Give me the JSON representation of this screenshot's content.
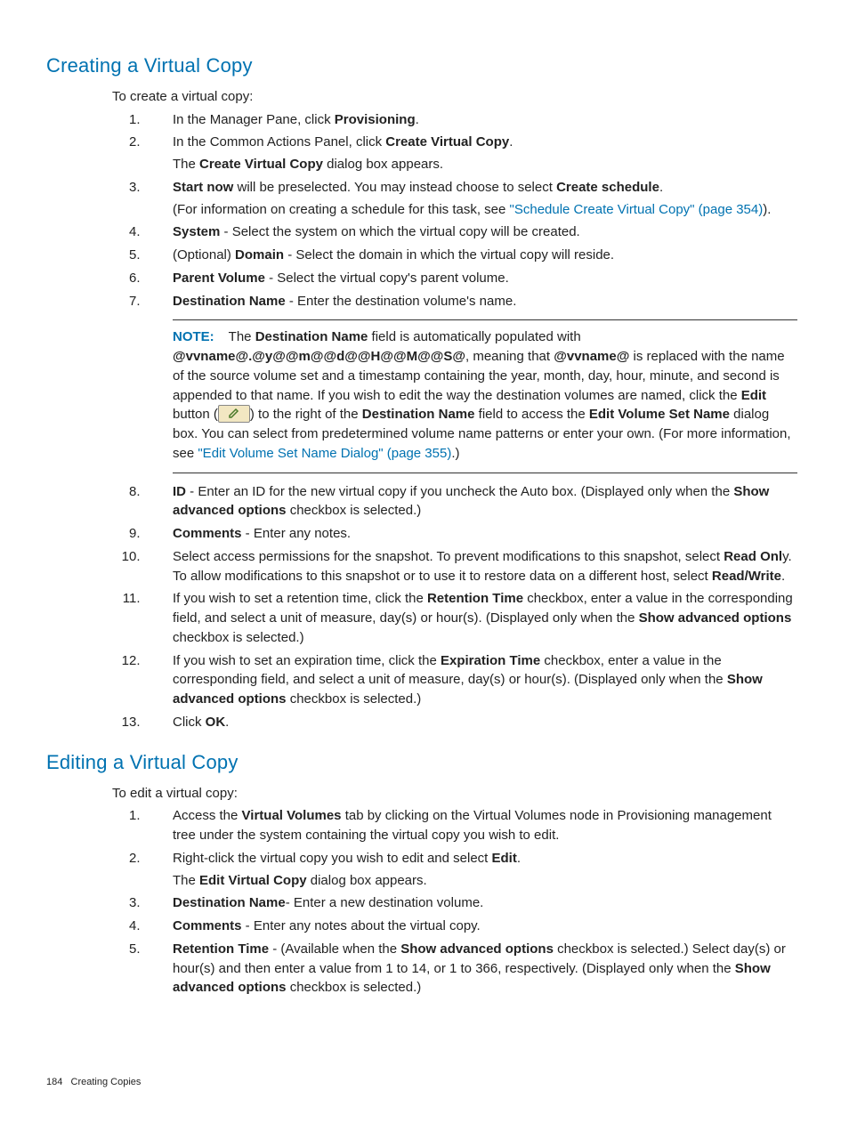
{
  "section1": {
    "title": "Creating a Virtual Copy",
    "intro": "To create a virtual copy:",
    "steps": {
      "s1a": "In the Manager Pane, click ",
      "s1b": "Provisioning",
      "s1c": ".",
      "s2a": "In the Common Actions Panel, click ",
      "s2b": "Create Virtual Copy",
      "s2c": ".",
      "s2d": "The ",
      "s2e": "Create Virtual Copy",
      "s2f": " dialog box appears.",
      "s3a": "Start now",
      "s3b": " will be preselected. You may instead choose to select ",
      "s3c": "Create schedule",
      "s3d": ".",
      "s3e": "(For information on creating a schedule for this task, see ",
      "s3f": "\"Schedule Create Virtual Copy\" (page 354)",
      "s3g": ").",
      "s4a": "System",
      "s4b": " - Select the system on which the virtual copy will be created.",
      "s5a": "(Optional) ",
      "s5b": "Domain",
      "s5c": " - Select the domain in which the virtual copy will reside.",
      "s6a": "Parent Volume",
      "s6b": " - Select the virtual copy's parent volume.",
      "s7a": "Destination Name",
      "s7b": " - Enter the destination volume's name.",
      "note": {
        "label": "NOTE:",
        "n1": "The ",
        "n2": "Destination Name",
        "n3": " field is automatically populated with ",
        "n4": "@vvname@.@y@@m@@d@@H@@M@@S@",
        "n5": ", meaning that ",
        "n6": "@vvname@",
        "n7": " is replaced with the name of the source volume set and a timestamp containing the year, month, day, hour, minute, and second is appended to that name. If you wish to edit the way the destination volumes are named, click the ",
        "n8": "Edit",
        "n9": " button (",
        "n10": ") to the right of the ",
        "n11": "Destination Name",
        "n12": " field to access the ",
        "n13": "Edit Volume Set Name",
        "n14": " dialog box. You can select from predetermined volume name patterns or enter your own. (For more information, see ",
        "n15": "\"Edit Volume Set Name Dialog\" (page 355)",
        "n16": ".)"
      },
      "s8a": "ID",
      "s8b": " - Enter an ID for the new virtual copy if you uncheck the Auto box. (Displayed only when the ",
      "s8c": "Show advanced options",
      "s8d": " checkbox is selected.)",
      "s9a": "Comments",
      "s9b": " - Enter any notes.",
      "s10a": "Select access permissions for the snapshot. To prevent modifications to this snapshot, select ",
      "s10b": "Read Onl",
      "s10c": "y. To allow modifications to this snapshot or to use it to restore data on a different host, select ",
      "s10d": "Read/Write",
      "s10e": ".",
      "s11a": "If you wish to set a retention time, click the ",
      "s11b": "Retention Time",
      "s11c": " checkbox, enter a value in the corresponding field, and select a unit of measure, day(s) or hour(s). (Displayed only when the ",
      "s11d": "Show advanced options",
      "s11e": " checkbox is selected.)",
      "s12a": "If you wish to set an expiration time, click the ",
      "s12b": "Expiration Time",
      "s12c": " checkbox, enter a value in the corresponding field, and select a unit of measure, day(s) or hour(s). (Displayed only when the ",
      "s12d": "Show advanced options",
      "s12e": " checkbox is selected.)",
      "s13a": "Click ",
      "s13b": "OK",
      "s13c": "."
    }
  },
  "section2": {
    "title": "Editing a Virtual Copy",
    "intro": "To edit a virtual copy:",
    "steps": {
      "s1a": "Access the ",
      "s1b": "Virtual Volumes",
      "s1c": " tab by clicking on the Virtual Volumes node in Provisioning management tree under the system containing the virtual copy you wish to edit.",
      "s2a": "Right-click the virtual copy you wish to edit and select ",
      "s2b": "Edit",
      "s2c": ".",
      "s2d": "The ",
      "s2e": "Edit Virtual Copy",
      "s2f": " dialog box appears.",
      "s3a": "Destination Name",
      "s3b": "- Enter a new destination volume.",
      "s4a": "Comments",
      "s4b": " - Enter any notes about the virtual copy.",
      "s5a": "Retention Time",
      "s5b": " - (Available when the ",
      "s5c": "Show advanced options",
      "s5d": " checkbox is selected.) Select day(s) or hour(s) and then enter a value from 1 to 14, or 1 to 366, respectively. (Displayed only when the ",
      "s5e": "Show advanced options",
      "s5f": " checkbox is selected.)"
    }
  },
  "footer": {
    "page": "184",
    "label": "Creating Copies"
  }
}
